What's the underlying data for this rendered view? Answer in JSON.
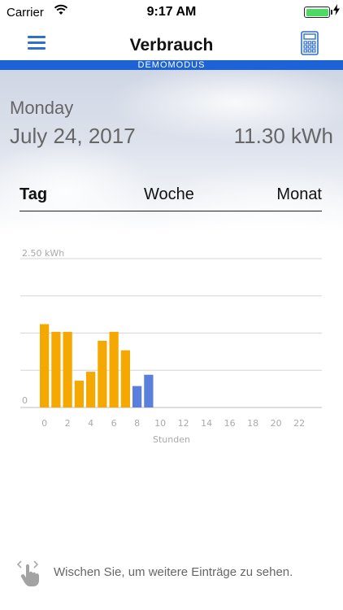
{
  "status_bar": {
    "carrier": "Carrier",
    "time": "9:17 AM",
    "battery_color": "#4cd964"
  },
  "navbar": {
    "title": "Verbrauch",
    "menu_icon": "hamburger-menu-icon",
    "calc_icon": "calculator-icon",
    "banner": "DEMOMODUS",
    "accent_color": "#1e63d6"
  },
  "summary": {
    "day": "Monday",
    "date": "July 24, 2017",
    "total": "11.30 kWh"
  },
  "tabs": {
    "day": "Tag",
    "week": "Woche",
    "month": "Monat",
    "active": "Tag"
  },
  "chart_data": {
    "type": "bar",
    "ymax_label": "2.50 kWh",
    "ymin_label": "0",
    "ylim": [
      0,
      2.5
    ],
    "xlabel": "Stunden",
    "x_ticks": [
      "0",
      "2",
      "4",
      "6",
      "8",
      "10",
      "12",
      "14",
      "16",
      "18",
      "20",
      "22"
    ],
    "hours": [
      0,
      1,
      2,
      3,
      4,
      5,
      6,
      7,
      8,
      9
    ],
    "values": [
      1.4,
      1.27,
      1.27,
      0.45,
      0.6,
      1.12,
      1.27,
      0.96,
      0.36,
      0.55
    ],
    "colors": [
      "#f5a800",
      "#f5a800",
      "#f5a800",
      "#f5a800",
      "#f5a800",
      "#f5a800",
      "#f5a800",
      "#f5a800",
      "#5b7fdc",
      "#5b7fdc"
    ],
    "grid": true
  },
  "hint": {
    "text": "Wischen Sie, um weitere Einträge zu sehen.",
    "icon": "swipe-hand-icon"
  }
}
